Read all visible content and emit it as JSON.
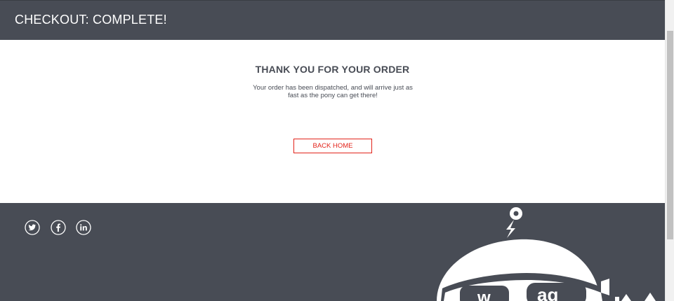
{
  "header": {
    "title": "CHECKOUT: COMPLETE!"
  },
  "main": {
    "heading": "THANK YOU FOR YOUR ORDER",
    "message": "Your order has been dispatched, and will arrive just as fast as the pony can get there!",
    "back_home_label": "BACK HOME"
  },
  "footer": {
    "social_icons": [
      "twitter-icon",
      "facebook-icon",
      "linkedin-icon"
    ],
    "mascot": "robot-mascot-logo"
  },
  "colors": {
    "header_bg": "#484c55",
    "footer_bg": "#484c55",
    "accent_red": "#e2231a",
    "text_dark": "#484c55"
  }
}
